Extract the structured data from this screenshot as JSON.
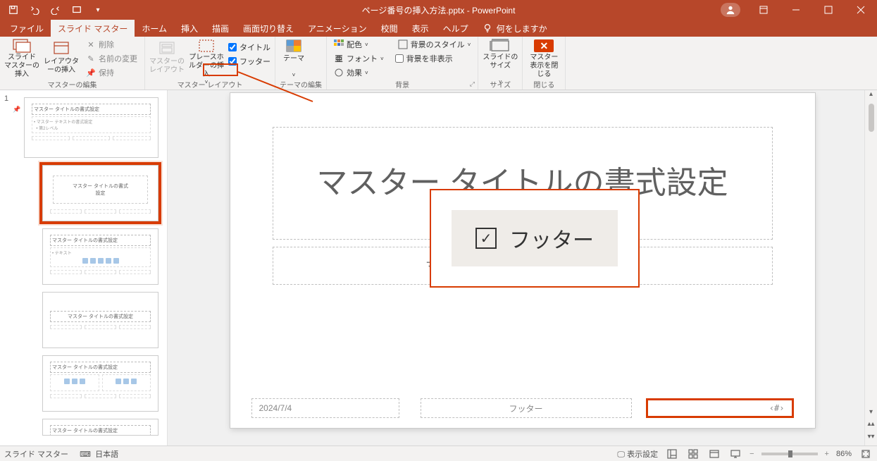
{
  "window": {
    "title_document": "ページ番号の挿入方法.pptx",
    "title_app": "PowerPoint"
  },
  "tabs": {
    "file": "ファイル",
    "slide_master": "スライド マスター",
    "home": "ホーム",
    "insert": "挿入",
    "draw": "描画",
    "transitions": "画面切り替え",
    "animations": "アニメーション",
    "review": "校閲",
    "view": "表示",
    "help": "ヘルプ",
    "tell_me": "何をしますか"
  },
  "ribbon": {
    "edit_master": {
      "insert_slide_master": "スライド マスターの挿入",
      "insert_layout": "レイアウターの挿入",
      "delete": "削除",
      "rename": "名前の変更",
      "preserve": "保持",
      "group": "マスターの編集"
    },
    "master_layout": {
      "master_layout": "マスターのレイアウト",
      "placeholder": "プレースホルダーの挿入",
      "title_checkbox": "タイトル",
      "footer_checkbox": "フッター",
      "group": "マスター レイアウト"
    },
    "edit_theme": {
      "themes": "テーマ",
      "group": "テーマの編集"
    },
    "background": {
      "colors": "配色",
      "fonts": "フォント",
      "effects": "効果",
      "bg_styles": "背景のスタイル",
      "hide_bg": "背景を非表示",
      "group": "背景"
    },
    "size": {
      "slide_size": "スライドのサイズ",
      "group": "サイズ"
    },
    "close": {
      "close_master": "マスター表示を閉じる",
      "group": "閉じる"
    }
  },
  "callout": {
    "footer_label": "フッター"
  },
  "thumbnails": {
    "index": "1",
    "master_title": "マスター タイトルの書式設定",
    "master_text": "マスター テキストの書式設定",
    "layout_title_centered": "マスター タイトルの書式\n設定"
  },
  "slide": {
    "title": "マスター タイトルの書式設定",
    "subtitle": "マスター サブタイトルの書式設定",
    "date": "2024/7/4",
    "footer": "フッター",
    "slide_number": "‹#›"
  },
  "status": {
    "mode": "スライド マスター",
    "lang_icon": "",
    "language": "日本語",
    "display_settings": "表示設定",
    "zoom": "86%",
    "zoom_plus": "+"
  }
}
